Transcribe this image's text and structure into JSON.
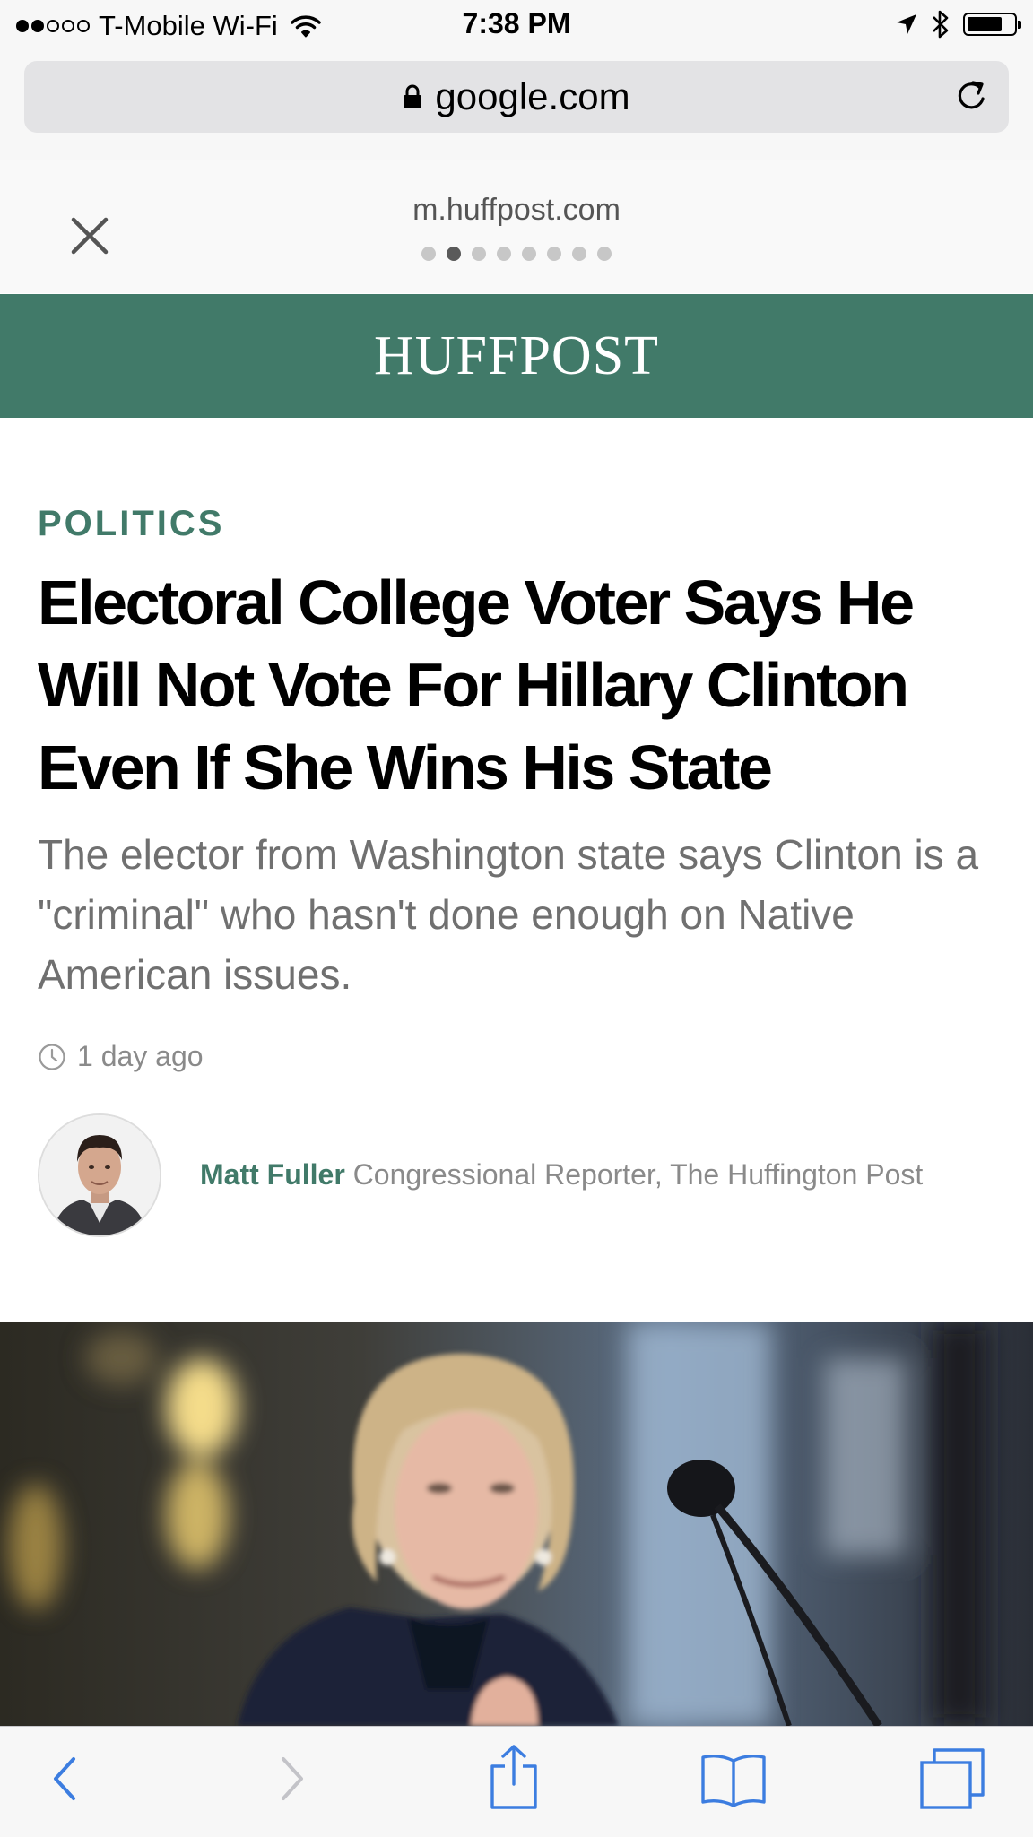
{
  "status_bar": {
    "carrier": "T-Mobile Wi-Fi",
    "time": "7:38 PM",
    "signal_bars_filled": 2,
    "signal_bars_total": 5,
    "battery_level": 0.75
  },
  "browser": {
    "url": "google.com",
    "secure": true
  },
  "amp_viewer": {
    "domain": "m.huffpost.com",
    "page_count": 8,
    "active_page": 2
  },
  "site": {
    "brand": "HUFFPOST",
    "brand_color": "#417a69"
  },
  "article": {
    "section": "POLITICS",
    "headline": "Electoral College Voter Says He Will Not Vote For Hillary Clinton Even If She Wins His State",
    "dek": "The elector from Washington state says Clinton is a \"criminal\" who hasn't done enough on Native American issues.",
    "timestamp": "1 day ago",
    "author": {
      "name": "Matt Fuller",
      "title": "Congressional Reporter, The Huffington Post"
    }
  },
  "toolbar": {
    "icons": [
      "back-icon",
      "forward-icon",
      "share-icon",
      "bookmarks-icon",
      "tabs-icon"
    ],
    "forward_enabled": false
  }
}
